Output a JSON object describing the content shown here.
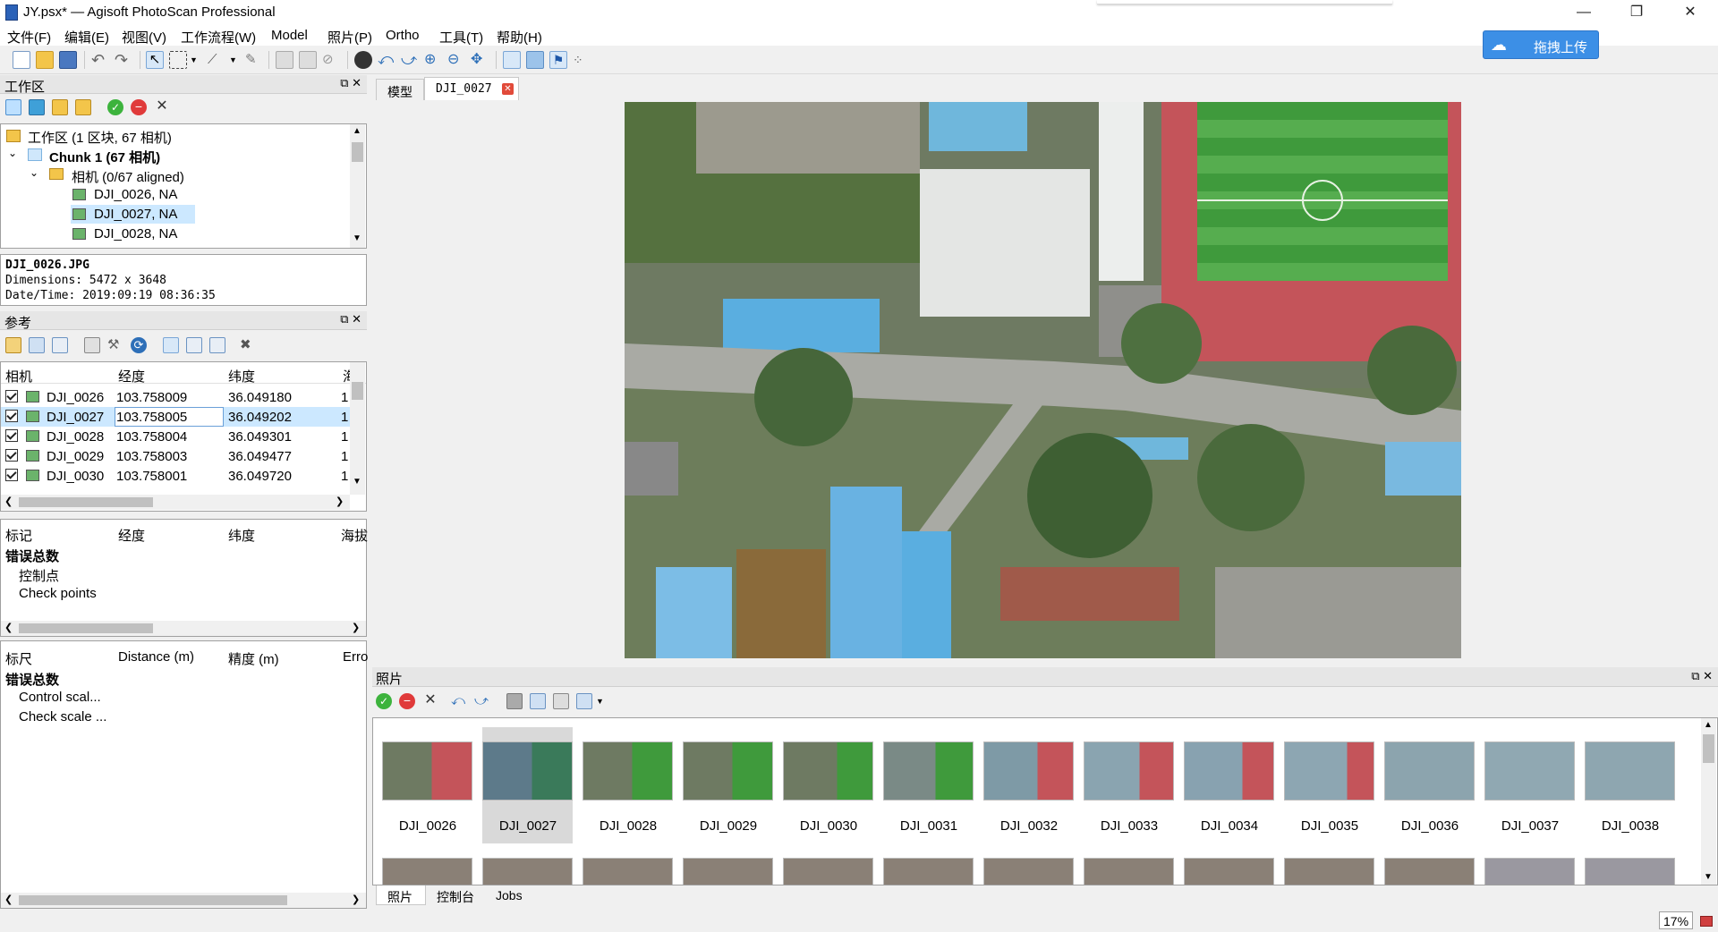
{
  "window": {
    "title": "JY.psx* — Agisoft PhotoScan Professional",
    "minimize": "—",
    "restore": "❐",
    "close": "✕"
  },
  "menu": [
    "文件(F)",
    "编辑(E)",
    "视图(V)",
    "工作流程(W)",
    "Model",
    "照片(P)",
    "Ortho",
    "工具(T)",
    "帮助(H)"
  ],
  "upload_button": "拖拽上传",
  "workspace": {
    "title": "工作区",
    "tree": [
      {
        "label": "工作区 (1 区块, 67 相机)"
      },
      {
        "label": "Chunk 1 (67 相机)"
      },
      {
        "label": "相机 (0/67 aligned)"
      },
      {
        "label": "DJI_0026, NA"
      },
      {
        "label": "DJI_0027, NA"
      },
      {
        "label": "DJI_0028, NA"
      }
    ]
  },
  "info": {
    "filename": "DJI_0026.JPG",
    "dimensions": "Dimensions: 5472 x 3648",
    "datetime": "Date/Time: 2019:09:19 08:36:35"
  },
  "reference": {
    "title": "参考",
    "camera_headers": [
      "相机",
      "经度",
      "纬度",
      "海"
    ],
    "cameras": [
      {
        "name": "DJI_0026",
        "lon": "103.758009",
        "lat": "36.049180",
        "alt": "1"
      },
      {
        "name": "DJI_0027",
        "lon": "103.758005",
        "lat": "36.049202",
        "alt": "1"
      },
      {
        "name": "DJI_0028",
        "lon": "103.758004",
        "lat": "36.049301",
        "alt": "1"
      },
      {
        "name": "DJI_0029",
        "lon": "103.758003",
        "lat": "36.049477",
        "alt": "1"
      },
      {
        "name": "DJI_0030",
        "lon": "103.758001",
        "lat": "36.049720",
        "alt": "1"
      }
    ],
    "marker_headers": [
      "标记",
      "经度",
      "纬度",
      "海拔"
    ],
    "marker_rows": [
      "错误总数",
      "控制点",
      "Check points"
    ],
    "scale_headers": [
      "标尺",
      "Distance (m)",
      "精度 (m)",
      "Erro"
    ],
    "scale_rows": [
      "错误总数",
      "Control scal...",
      "Check scale ..."
    ]
  },
  "doc_tabs": [
    {
      "label": "模型"
    },
    {
      "label": "DJI_0027"
    }
  ],
  "photos": {
    "title": "照片",
    "items": [
      "DJI_0026",
      "DJI_0027",
      "DJI_0028",
      "DJI_0029",
      "DJI_0030",
      "DJI_0031",
      "DJI_0032",
      "DJI_0033",
      "DJI_0034",
      "DJI_0035",
      "DJI_0036",
      "DJI_0037",
      "DJI_0038"
    ],
    "selected": "DJI_0027"
  },
  "bottom_tabs": [
    "照片",
    "控制台",
    "Jobs"
  ],
  "status": {
    "zoom": "17%"
  },
  "colors": {
    "accent": "#3c8fe6",
    "selection": "#cce8ff",
    "field_green": "#3f9a3c",
    "track_red": "#c4545a",
    "roof_blue": "#5aaee0"
  }
}
